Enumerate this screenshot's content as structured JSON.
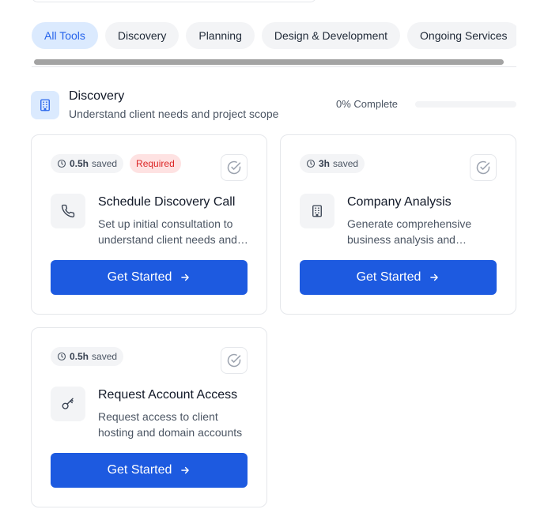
{
  "tabs": [
    {
      "label": "All Tools",
      "active": true
    },
    {
      "label": "Discovery",
      "active": false
    },
    {
      "label": "Planning",
      "active": false
    },
    {
      "label": "Design & Development",
      "active": false
    },
    {
      "label": "Ongoing Services",
      "active": false
    }
  ],
  "section": {
    "title": "Discovery",
    "subtitle": "Understand client needs and project scope",
    "progress_label": "0% Complete",
    "progress_fraction": 0,
    "icon": "building-icon"
  },
  "cards": [
    {
      "saved_value": "0.5h",
      "saved_label": "saved",
      "required_label": "Required",
      "title": "Schedule Discovery Call",
      "description": "Set up initial consultation to understand client needs and project goals",
      "cta": "Get Started",
      "icon": "phone-icon"
    },
    {
      "saved_value": "3h",
      "saved_label": "saved",
      "title": "Company Analysis",
      "description": "Generate comprehensive business analysis and competitor research",
      "cta": "Get Started",
      "icon": "building-icon"
    },
    {
      "saved_value": "0.5h",
      "saved_label": "saved",
      "title": "Request Account Access",
      "description": "Request access to client hosting and domain accounts",
      "cta": "Get Started",
      "icon": "key-icon"
    }
  ],
  "colors": {
    "accent": "#1d5ae0",
    "tab_active_bg": "#dbeafe",
    "tab_active_text": "#2563eb",
    "required_bg": "#fee2e2",
    "required_text": "#dc2626"
  }
}
